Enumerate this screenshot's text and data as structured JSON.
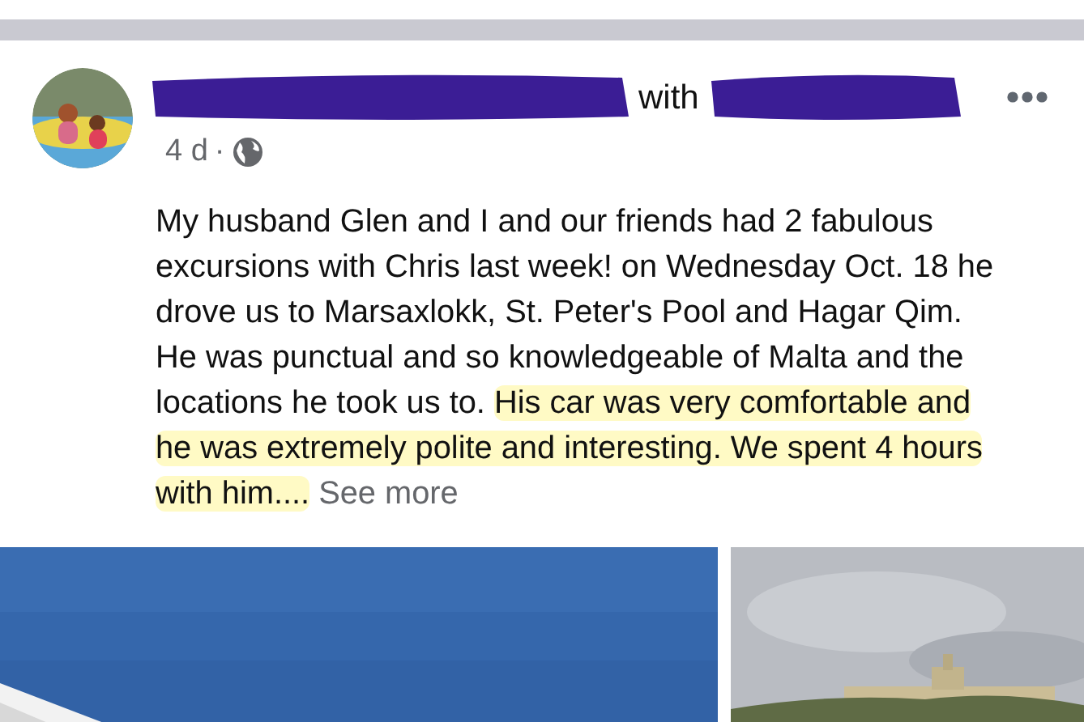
{
  "post": {
    "author_joiner": "with",
    "time": "4 d",
    "separator": "·",
    "body_lines": [
      [
        {
          "text": "My husband Glen and I and our friends had 2 fabulous",
          "highlighted": false
        }
      ],
      [
        {
          "text": "excursions with Chris last week! on Wednesday Oct. 18 he",
          "highlighted": false
        }
      ],
      [
        {
          "text": "drove us to Marsaxlokk, St. Peter's Pool and Hagar Qim.",
          "highlighted": false
        }
      ],
      [
        {
          "text": "He was punctual and so knowledgeable of Malta and the",
          "highlighted": false
        }
      ],
      [
        {
          "text": "locations he took us to. ",
          "highlighted": false
        },
        {
          "text": "His car was very comfortable and",
          "highlighted": true
        }
      ],
      [
        {
          "text": "he was extremely polite and interesting. We spent 4 hours",
          "highlighted": true
        }
      ],
      [
        {
          "text": "with him....",
          "highlighted": true
        }
      ]
    ],
    "see_more": "See more",
    "photos": [
      {
        "kind": "picture"
      },
      {
        "kind": "picture"
      }
    ]
  }
}
